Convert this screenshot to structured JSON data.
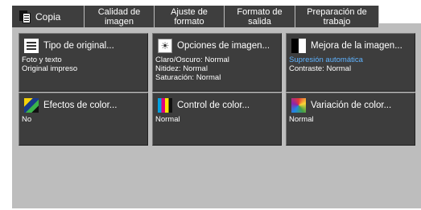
{
  "tabs": [
    {
      "label": "Copia"
    },
    {
      "line1": "Calidad de",
      "line2": "imagen"
    },
    {
      "line1": "Ajuste de",
      "line2": "formato"
    },
    {
      "line1": "Formato de",
      "line2": "salida"
    },
    {
      "line1": "Preparación de",
      "line2": "trabajo"
    }
  ],
  "options": [
    {
      "title": "Tipo de original...",
      "icon": "document-icon",
      "lines": [
        "Foto y texto",
        "Original impreso"
      ]
    },
    {
      "title": "Opciones de imagen...",
      "icon": "brightness-icon",
      "lines": [
        "Claro/Oscuro: Normal",
        "Nitidez: Normal",
        "Saturación: Normal"
      ]
    },
    {
      "title": "Mejora de la imagen...",
      "icon": "contrast-icon",
      "lines": [
        "Supresión automática",
        "Contraste: Normal"
      ],
      "highlight_color": "#5fb3ff"
    },
    {
      "title": "Efectos de color...",
      "icon": "color-effects-icon",
      "lines": [
        "No"
      ]
    },
    {
      "title": "Control de color...",
      "icon": "color-control-icon",
      "lines": [
        "Normal"
      ]
    },
    {
      "title": "Variación de color...",
      "icon": "color-variation-icon",
      "lines": [
        "Normal"
      ]
    }
  ]
}
